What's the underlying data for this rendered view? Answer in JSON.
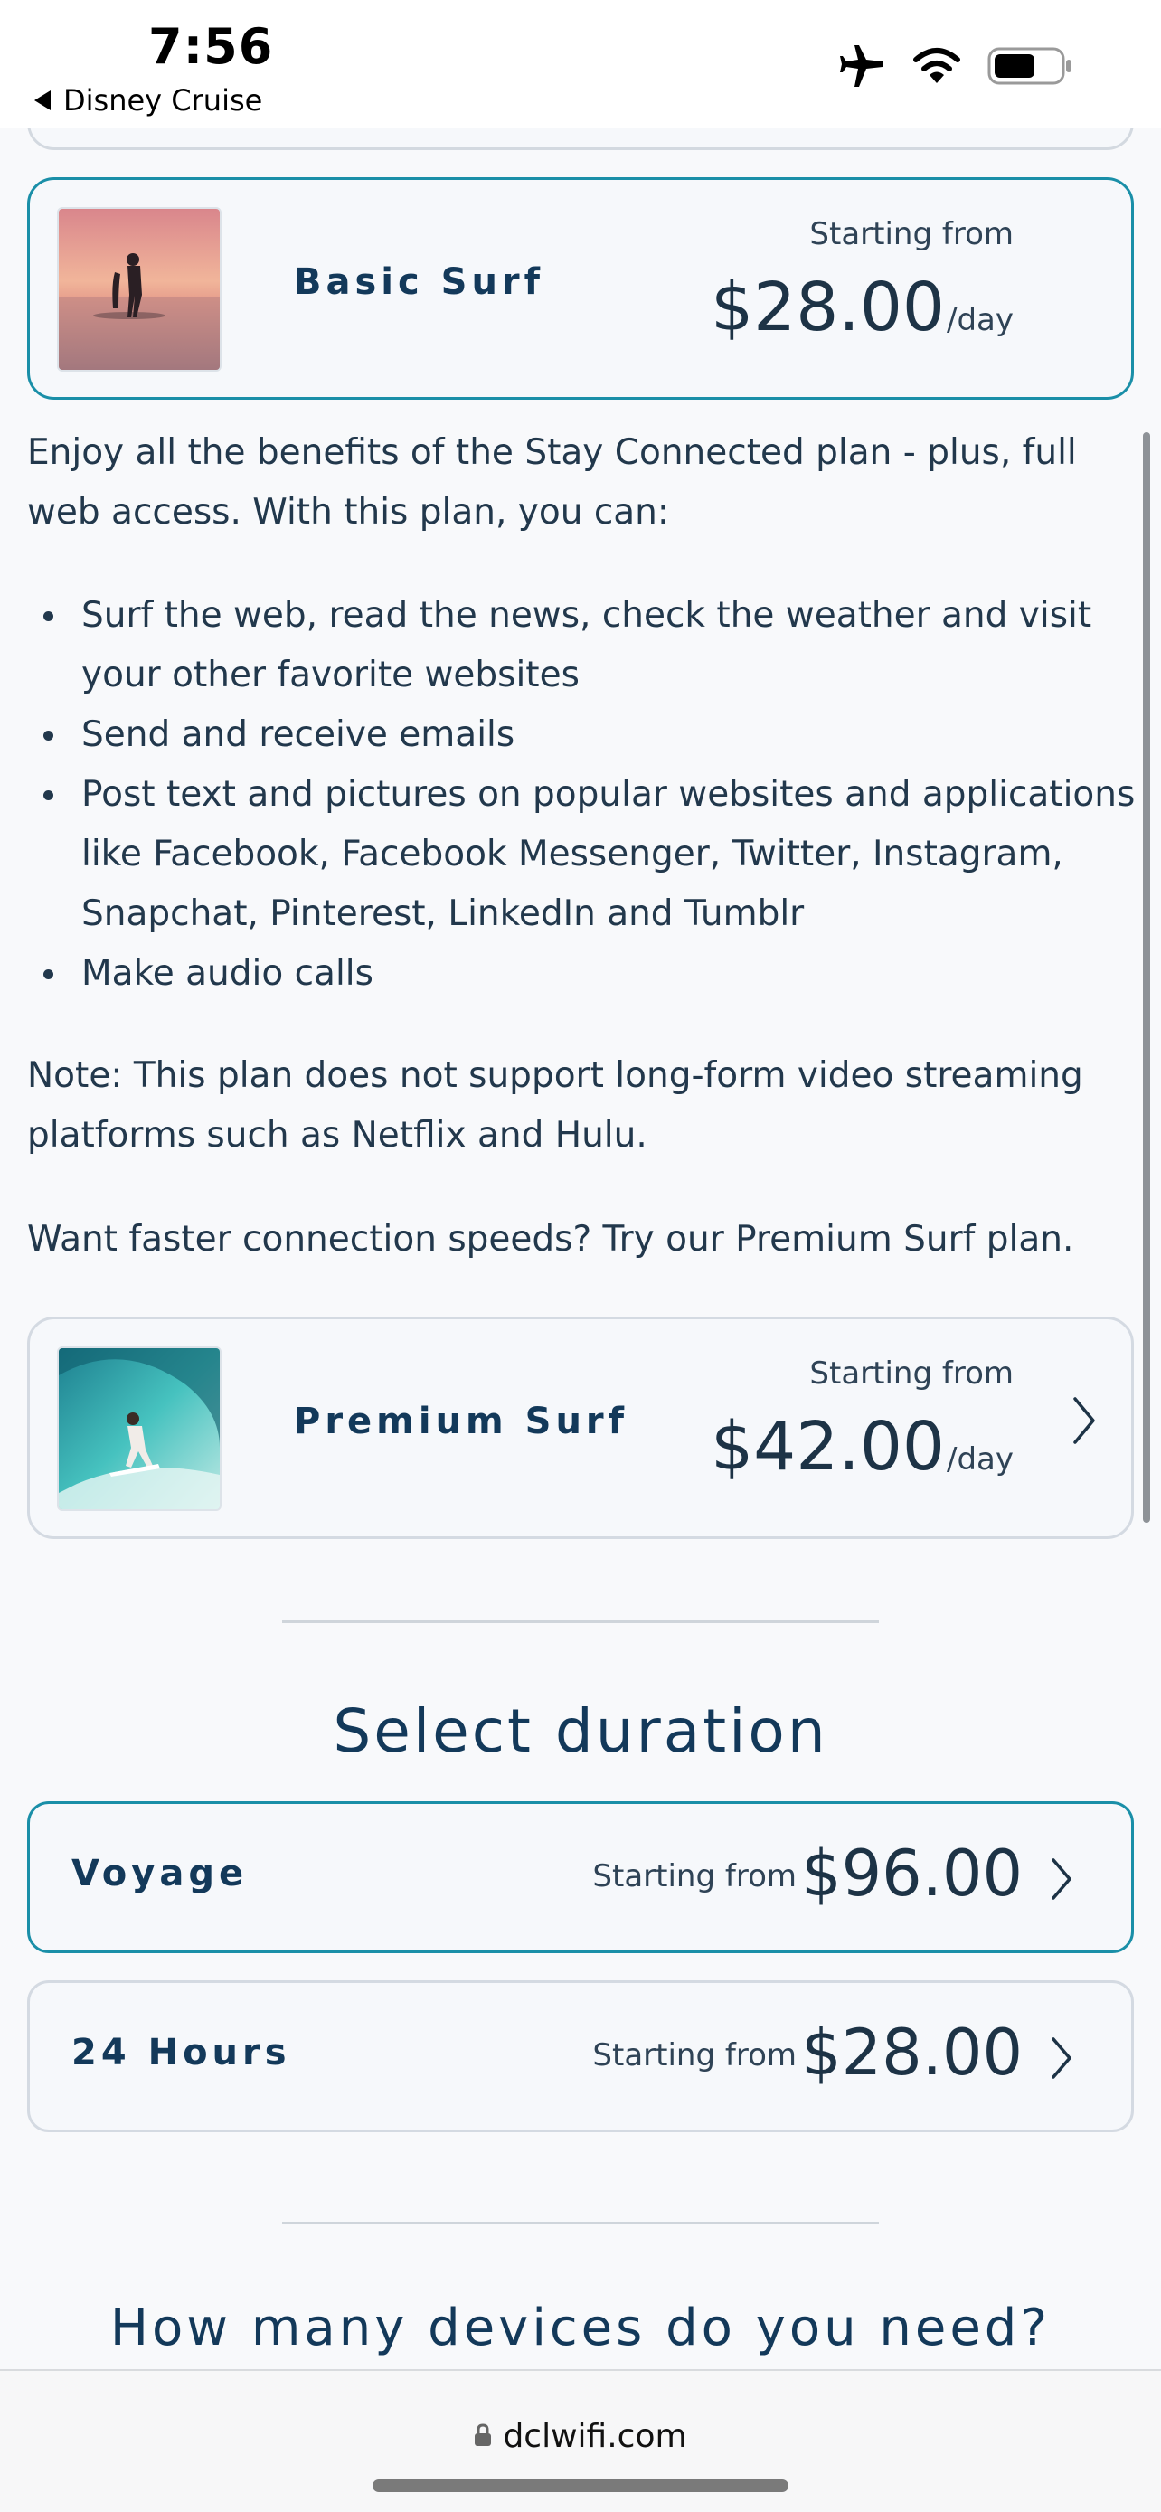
{
  "status_bar": {
    "time": "7:56",
    "back_app": "Disney Cruise",
    "icons": [
      "airplane-icon",
      "wifi-icon",
      "battery-icon"
    ]
  },
  "current_plan": {
    "name": "Basic Surf",
    "starting_from": "Starting from",
    "price": "$28.00",
    "unit": "/day",
    "thumbnail": "surfer-sunset-photo"
  },
  "description": {
    "intro": "Enjoy all the benefits of the Stay Connected plan - plus, full web access. With this plan, you can:",
    "bullets": [
      "Surf the web, read the news, check the weather and visit your other favorite websites",
      "Send and receive emails",
      "Post text and pictures on popular websites and applications like Facebook, Facebook Messenger, Twitter, Instagram, Snapchat, Pinterest, LinkedIn and Tumblr",
      "Make audio calls"
    ],
    "note": "Note: This plan does not support long-form video streaming platforms such as Netflix and Hulu.",
    "upsell": "Want faster connection speeds? Try our Premium Surf plan."
  },
  "upsell_plan": {
    "name": "Premium Surf",
    "starting_from": "Starting from",
    "price": "$42.00",
    "unit": "/day",
    "thumbnail": "surfer-wave-photo"
  },
  "duration": {
    "title": "Select duration",
    "options": [
      {
        "label": "Voyage",
        "starting_from": "Starting from",
        "price": "$96.00"
      },
      {
        "label": "24 Hours",
        "starting_from": "Starting from",
        "price": "$28.00"
      }
    ]
  },
  "devices": {
    "title": "How many devices do you need?"
  },
  "browser": {
    "url": "dclwifi.com"
  },
  "colors": {
    "accent": "#1a8fa8",
    "heading": "#13395a",
    "text": "#22384c",
    "background": "#f8f9fb"
  }
}
